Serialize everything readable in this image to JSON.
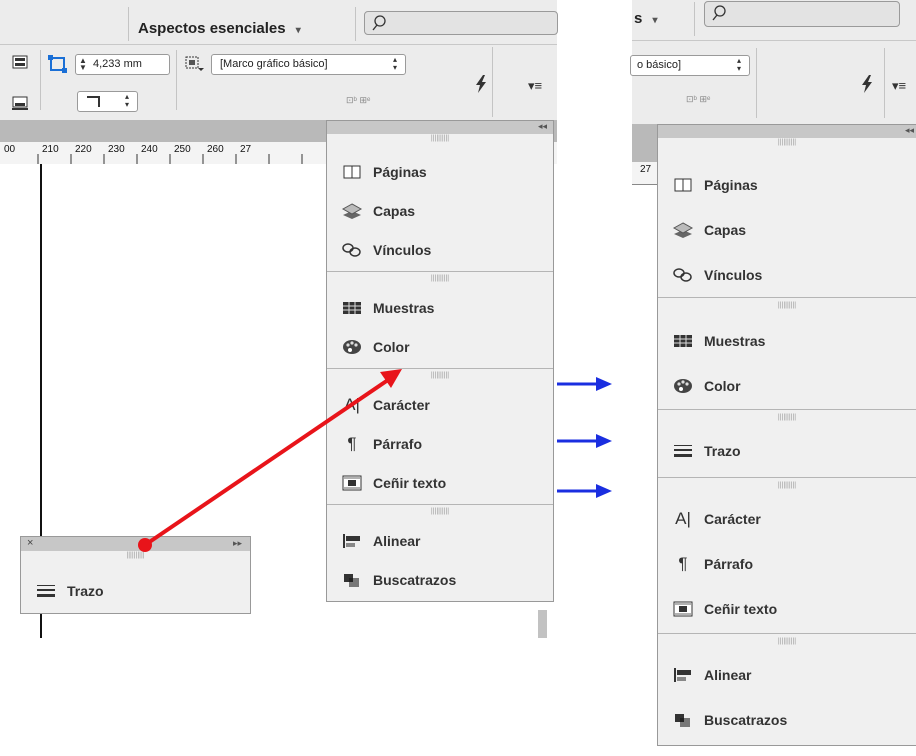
{
  "toolbar_left": {
    "workspace_label": "Aspectos esenciales",
    "workspace_caret": "▾",
    "stroke_weight_value": "4,233 mm",
    "frame_style": "[Marco gráfico básico]",
    "ruler_ticks": [
      "00",
      "210",
      "220",
      "230",
      "240",
      "250",
      "260",
      "27"
    ]
  },
  "toolbar_right": {
    "workspace_label_fragment": "s",
    "workspace_caret": "▾",
    "frame_style_fragment": "o básico]"
  },
  "panel_left": {
    "collapse_glyph": "◂◂",
    "group1": [
      {
        "label": "Páginas",
        "icon": "pages-icon"
      },
      {
        "label": "Capas",
        "icon": "layers-icon"
      },
      {
        "label": "Vínculos",
        "icon": "links-icon"
      }
    ],
    "group2": [
      {
        "label": "Muestras",
        "icon": "swatches-icon"
      },
      {
        "label": "Color",
        "icon": "color-palette-icon"
      }
    ],
    "group3": [
      {
        "label": "Carácter",
        "icon": "character-icon"
      },
      {
        "label": "Párrafo",
        "icon": "paragraph-icon"
      },
      {
        "label": "Ceñir texto",
        "icon": "text-wrap-icon"
      }
    ],
    "group4": [
      {
        "label": "Alinear",
        "icon": "align-icon"
      },
      {
        "label": "Buscatrazos",
        "icon": "pathfinder-icon"
      }
    ]
  },
  "floating_panel": {
    "close_glyph": "×",
    "expand_glyph": "▸▸",
    "item": {
      "label": "Trazo",
      "icon": "stroke-icon"
    }
  },
  "panel_right": {
    "collapse_glyph": "◂◂",
    "group1": [
      {
        "label": "Páginas",
        "icon": "pages-icon"
      },
      {
        "label": "Capas",
        "icon": "layers-icon"
      },
      {
        "label": "Vínculos",
        "icon": "links-icon"
      }
    ],
    "group2": [
      {
        "label": "Muestras",
        "icon": "swatches-icon"
      },
      {
        "label": "Color",
        "icon": "color-palette-icon"
      }
    ],
    "group3": [
      {
        "label": "Trazo",
        "icon": "stroke-icon"
      }
    ],
    "group4": [
      {
        "label": "Carácter",
        "icon": "character-icon"
      },
      {
        "label": "Párrafo",
        "icon": "paragraph-icon"
      },
      {
        "label": "Ceñir texto",
        "icon": "text-wrap-icon"
      }
    ],
    "group5": [
      {
        "label": "Alinear",
        "icon": "align-icon"
      },
      {
        "label": "Buscatrazos",
        "icon": "pathfinder-icon"
      }
    ]
  },
  "annotation_colors": {
    "drag_arrow": "#e8141a",
    "indicator_arrows": "#1a2ee0"
  }
}
